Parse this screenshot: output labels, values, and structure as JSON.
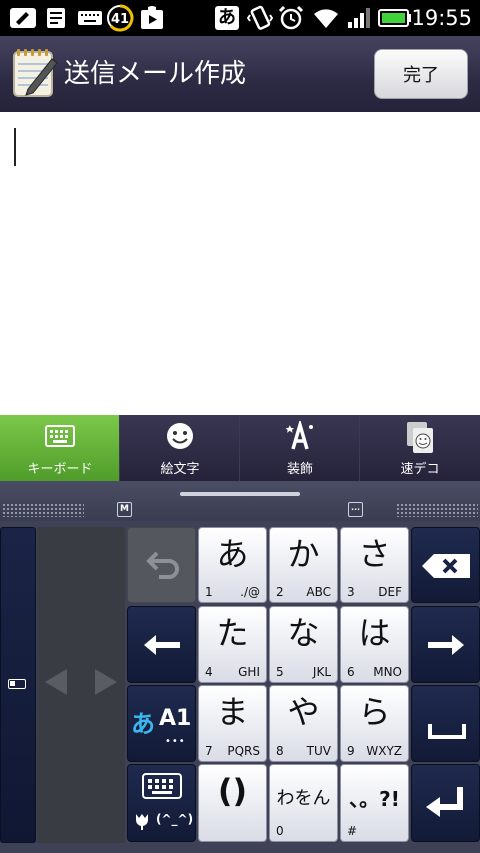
{
  "status_bar": {
    "time": "19:55",
    "battery_level_badge": "41",
    "ime_indicator": "あ",
    "icons": [
      "edit-note-icon",
      "memo-icon",
      "keyboard-icon",
      "battery-circle-icon",
      "play-store-icon",
      "ime-icon",
      "vibrate-icon",
      "alarm-icon",
      "wifi-icon",
      "signal-icon",
      "battery-icon"
    ]
  },
  "title_bar": {
    "title": "送信メール作成",
    "done_label": "完了"
  },
  "compose": {
    "body_text": ""
  },
  "tool_tabs": [
    {
      "label": "キーボード",
      "icon": "keyboard-icon",
      "active": true
    },
    {
      "label": "絵文字",
      "icon": "smiley-icon",
      "active": false
    },
    {
      "label": "装飾",
      "icon": "decoration-icon",
      "active": false
    },
    {
      "label": "速デコ",
      "icon": "quick-deco-icon",
      "active": false
    }
  ],
  "keyboard": {
    "mode_badge": "M",
    "more_badge": "···",
    "keys": {
      "a": {
        "main": "あ",
        "num": "1",
        "sub": "./@"
      },
      "ka": {
        "main": "か",
        "num": "2",
        "sub": "ABC"
      },
      "sa": {
        "main": "さ",
        "num": "3",
        "sub": "DEF"
      },
      "ta": {
        "main": "た",
        "num": "4",
        "sub": "GHI"
      },
      "na": {
        "main": "な",
        "num": "5",
        "sub": "JKL"
      },
      "ha": {
        "main": "は",
        "num": "6",
        "sub": "MNO"
      },
      "ma": {
        "main": "ま",
        "num": "7",
        "sub": "PQRS"
      },
      "ya": {
        "main": "や",
        "num": "8",
        "sub": "TUV"
      },
      "ra": {
        "main": "ら",
        "num": "9",
        "sub": "WXYZ"
      },
      "paren": {
        "main": "()"
      },
      "wa": {
        "main": "わをん",
        "num": "0"
      },
      "punct": {
        "main": "、。?!",
        "num": "#"
      }
    },
    "mode_key": {
      "kana": "あ",
      "alpha": "A1",
      "dots": "•••"
    },
    "emoji_key": {
      "face": "(^_^)"
    }
  }
}
